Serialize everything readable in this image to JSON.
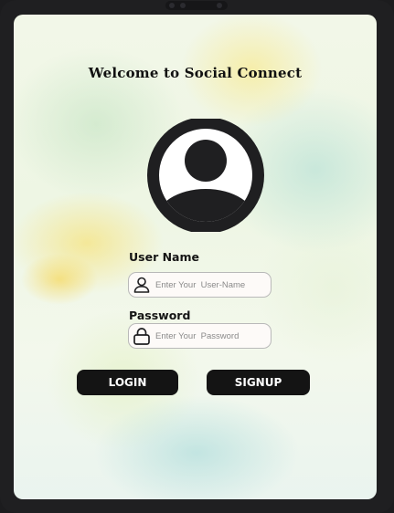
{
  "header": {
    "title": "Welcome to Social Connect"
  },
  "avatar": {
    "icon": "user-avatar-icon"
  },
  "form": {
    "username": {
      "label": "User Name",
      "placeholder": "Enter Your  User-Name",
      "value": "",
      "icon": "user-icon"
    },
    "password": {
      "label": "Password",
      "placeholder": "Enter Your  Password",
      "value": "",
      "icon": "lock-icon"
    }
  },
  "actions": {
    "login_label": "LOGIN",
    "signup_label": "SIGNUP"
  },
  "colors": {
    "button_bg": "#141414",
    "button_text": "#ffffff",
    "field_bg": "#fdfaf8",
    "icon_dark": "#1f1f21"
  }
}
